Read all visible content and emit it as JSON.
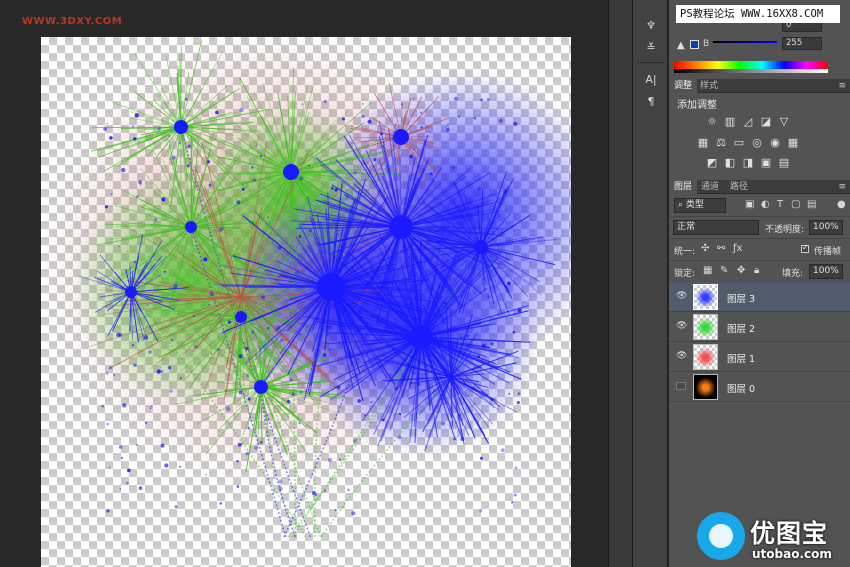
{
  "watermarks": {
    "left": "WWW.3DXY.COM",
    "top": "PS教程论坛 WWW.16XX8.COM",
    "logo_main": "优图宝",
    "logo_sub": "utobao.com"
  },
  "color_panel": {
    "rows": [
      {
        "label": "",
        "value": "0"
      },
      {
        "label": "B",
        "value": "255"
      }
    ]
  },
  "adjustments_panel": {
    "tabs": [
      {
        "label": "调整",
        "active": true
      },
      {
        "label": "样式",
        "active": false
      }
    ],
    "title": "添加调整"
  },
  "layers_panel": {
    "tabs": [
      {
        "label": "图层",
        "active": true
      },
      {
        "label": "通道",
        "active": false
      },
      {
        "label": "路径",
        "active": false
      }
    ],
    "filter_kind": "类型",
    "blend_mode": "正常",
    "opacity_label": "不透明度:",
    "opacity_value": "100%",
    "unify_label": "统一:",
    "propagate_label": "传播帧",
    "propagate_checked": true,
    "lock_label": "锁定:",
    "fill_label": "填充:",
    "fill_value": "100%",
    "layers": [
      {
        "name": "图层 3",
        "visible": true,
        "selected": true,
        "thumb_color": "#2f3dff"
      },
      {
        "name": "图层 2",
        "visible": true,
        "selected": false,
        "thumb_color": "#3cd93c"
      },
      {
        "name": "图层 1",
        "visible": true,
        "selected": false,
        "thumb_color": "#f05050"
      },
      {
        "name": "图层 0",
        "visible": false,
        "selected": false,
        "thumb_color": "#ff7a1a"
      }
    ]
  },
  "colors": {
    "firework_blue": "#1a1aff",
    "firework_green": "#3fc21f",
    "firework_red": "#c0504d",
    "selection_highlight": "#505c6a"
  }
}
